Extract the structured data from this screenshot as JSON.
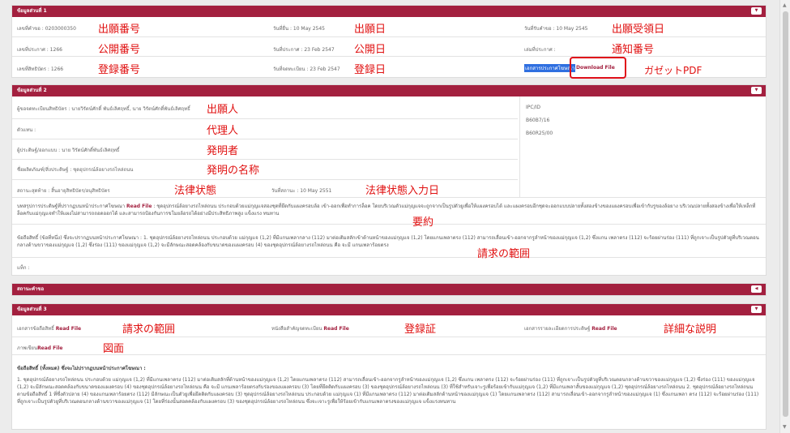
{
  "section1": {
    "title": "ข้อมูลส่วนที่ 1",
    "row1": {
      "c1": "เลขที่คำขอ : 0203000350",
      "c2": "วันที่ยื่น : 10 May 2545",
      "c3": "วันที่รับคำขอ : 10 May 2545",
      "a1": "出願番号",
      "a2": "出願日",
      "a3": "出願受領日"
    },
    "row2": {
      "c1": "เลขที่ประกาศ : 1266",
      "c2": "วันที่ประกาศ : 23 Feb 2547",
      "c3": "เล่มที่ประกาศ :",
      "a1": "公開番号",
      "a2": "公開日",
      "a3": "通知番号"
    },
    "row3": {
      "c1": "เลขที่สิทธิบัตร : 1266",
      "c2": "วันที่จดทะเบียน : 23 Feb 2547",
      "c3": "เอกสารประกาศโฆษณา",
      "download": "Download File",
      "a1": "登録番号",
      "a2": "登録日",
      "a3": "ガゼットPDF"
    }
  },
  "section2": {
    "title": "ข้อมูลส่วนที่ 2",
    "applicant": "ผู้ขอจดทะเบียนสิทธิบัตร : นายวิรัตน์ศักดิ์ พันธ์เลิศฤทธิ์, นาย วิรัตน์ศักดิ์พันธ์เลิศฤทธิ์",
    "agent": "ตัวแทน :",
    "inventor": "ผู้ประดิษฐ์/ออกแบบ : นาย วิรัตน์ศักดิ์พันธ์เลิศฤทธิ์",
    "invention": "ชื่อผลิตภัณฑ์/สิ่งประดิษฐ์ : ชุดอุปกรณ์ล้อยางรถไหล่ถนน",
    "status": "สถานะสุดท้าย : สิ้นอายุสิทธิบัตร/อนุสิทธิบัตร",
    "status_date": "วันที่สถานะ : 10 May 2551",
    "ipc_title": "IPC/ID",
    "ipc1": "B60B7/16",
    "ipc2": "B60R25/00",
    "a_applicant": "出願人",
    "a_agent": "代理人",
    "a_inventor": "発明者",
    "a_invention": "発明の名称",
    "a_status": "法律状態",
    "a_status_date": "法律状態入力日",
    "abstract": "บทสรุปการประดิษฐ์ที่ปรากฏบนหน้าประกาศโฆษณา",
    "abstract_link": "Read File",
    "abstract_text": " : ชุดอุปกรณ์ล้อยางรถไหล่ถนน ประกอบด้วยแม่กุญแจสองชุดที่ยึดกับแผงครอบล้อ เข้า-ออกเพื่อทำการล็อค โดยบริเวณตัวแม่กุญแจจะถูกจากเป็นรูปตัวยูเพื่อให้แผงครอบได้ และแผงครอบอีกชุดจะออกแบบปลายทั้งสองข้างของแผงครอบเพื่อเข้ากับรูของล้อยาง บริเวณปลายทั้งสองข้างเพื่อให้เหล็กที่ล็อคกับแม่กุญแจทำให้แผงไม่สามารถถอดออกได้ และสามารถป้องกันการขโมยล้อรถได้อย่างมีประสิทธิภาพสูง แข็งแรง ทนทาน",
    "a_abstract": "要約",
    "claims": "ข้อถือสิทธิ์ (ข้อที่หนึ่ง) ซึ่งจะปรากฏบนหน้าประกาศโฆษณา",
    "claims_text": " : 1. ชุดอุปกรณ์ล้อยางรถไหล่ถนน ประกอบด้วย แม่กุญแจ (1,2) ที่มีแกนเพลากลาง (112) มาต่อเติมสลักเข้าด้านหน้าของแม่กุญแจ (1,2) โดยแกนเพลาตรง (112) สามารถเลื่อนเข้า-ออกจากรูลำหน้าของแม่กุญแจ (1,2) ซึ่งแกน เพลาตรง (112) จะร้อยผ่านร่อง (111) ที่ถูกเจาะเป็นรูปตัวยูที่บริเวณตอนกลางด้านขวาของแม่กุญแจ (1,2) ซึ่งร่อง (111) ของแม่กุญแจ (1,2) จะมีลักษณะสอดคล้องกับขนาดของแผงครอบ (4) ของชุดอุปกรณ์ล้อยางรถไหล่ถนน คือ จะมี แกนเพลาร้อยตรง",
    "a_claims": "請求の範囲",
    "note": "แท็ก :"
  },
  "section_status": {
    "title": "สถานะคำขอ"
  },
  "section3": {
    "title": "ข้อมูลส่วนที่ 3",
    "claims_doc": "เอกสารข้อถือสิทธิ์",
    "certificate": "หนังสือสำคัญจดทะเบียน",
    "description": "เอกสารรายละเอียดการประดิษฐ์",
    "drawing": "ภาพเขียน",
    "read": "Read File",
    "a_claims": "請求の範囲",
    "a_certificate": "登録証",
    "a_description": "詳細な説明",
    "a_drawing": "図面",
    "claims_heading": "ข้อถือสิทธิ์ (ทั้งหมด) ซึ่งจะไม่ปรากฏบนหน้าประกาศโฆษณา :",
    "claims_full": "1. ชุดอุปกรณ์ล้อยางรถไหล่ถนน ประกอบด้วย แม่กุญแจ (1,2) ที่มีแกนเพลาตรง (112) มาต่อเติมสลักที่ด้านหน้าของแม่กุญแจ (1,2) โดยแกนเพลาตรง (112) สามารถเลื่อนเข้า-ออกจากรูลำหน้าของแม่กุญแจ (1,2) ซึ่งแกน เพลาตรง (112) จะร้อยผ่านร่อง (111) ที่ถูกเจาะเป็นรูปตัวยูที่บริเวณตอนกลางด้านขวาของแม่กุญแจ (1,2) ซึ่งร่อง (111) ของแม่กุญแจ (1,2) จะมีลักษณะสอดคล้องกับขนาดของแผงครอบ (4) ของชุดอุปกรณ์ล้อยางรถไหล่ถนน คือ จะมี แกนเพลาร้อยตรงกับร่องของแผงครอบ (3) โดยที่ยึดติดกับแผงครอบ (3) ของชุดอุปกรณ์ล้อยางรถไหล่ถนน (3) ที่ใช้สำหรับเจาะรูเพื่อร้อยเข้ากับแม่กุญแจ (1,2) ที่มีแกนเพลาสั้นของแม่กุญแจ (1,2) ชุดอุปกรณ์ล้อยางรถไหล่ถนน 2. ชุดอุปกรณ์ล้อยางรถไหล่ถนน ตามข้อถือสิทธิ์ 1 ที่ซึ่งตัวปลาย (4) ของแกนเพลาร้อยตรง (112) มีลักษณะเป็นตัวยูเพื่อยึดติดกับแผงครอบ (3) ชุดอุปกรณ์ล้อยางรถไหล่ถนน ประกอบด้วย แม่กุญแจ (1) ที่มีแกนเพลาตรง (112) มาต่อเติมสลักด้านหน้าของแม่กุญแจ (1) โดยแกนเพลาตรง (112) สามารถเลื่อนเข้า-ออกจากรูลำหน้าของแม่กุญแจ (1) ซึ่งแกนเพลา ตรง (112) จะร้อยผ่านร่อง (111) ที่ถูกเจาะเป็นรูปตัวยูที่บริเวณตอนกลางด้านขวาของแม่กุญแจ (1) โดยที่ร่องนั้นสอดคล้องกับแผงครอบ (3) ของชุดอุปกรณ์ล้อยางรถไหล่ถนน ซึ่งจะเจาะรูเพื่อให้ร้อยเข้ากับแกนเพลาตรงของแม่กุญแจ แข็งแรงทนทาน"
  }
}
